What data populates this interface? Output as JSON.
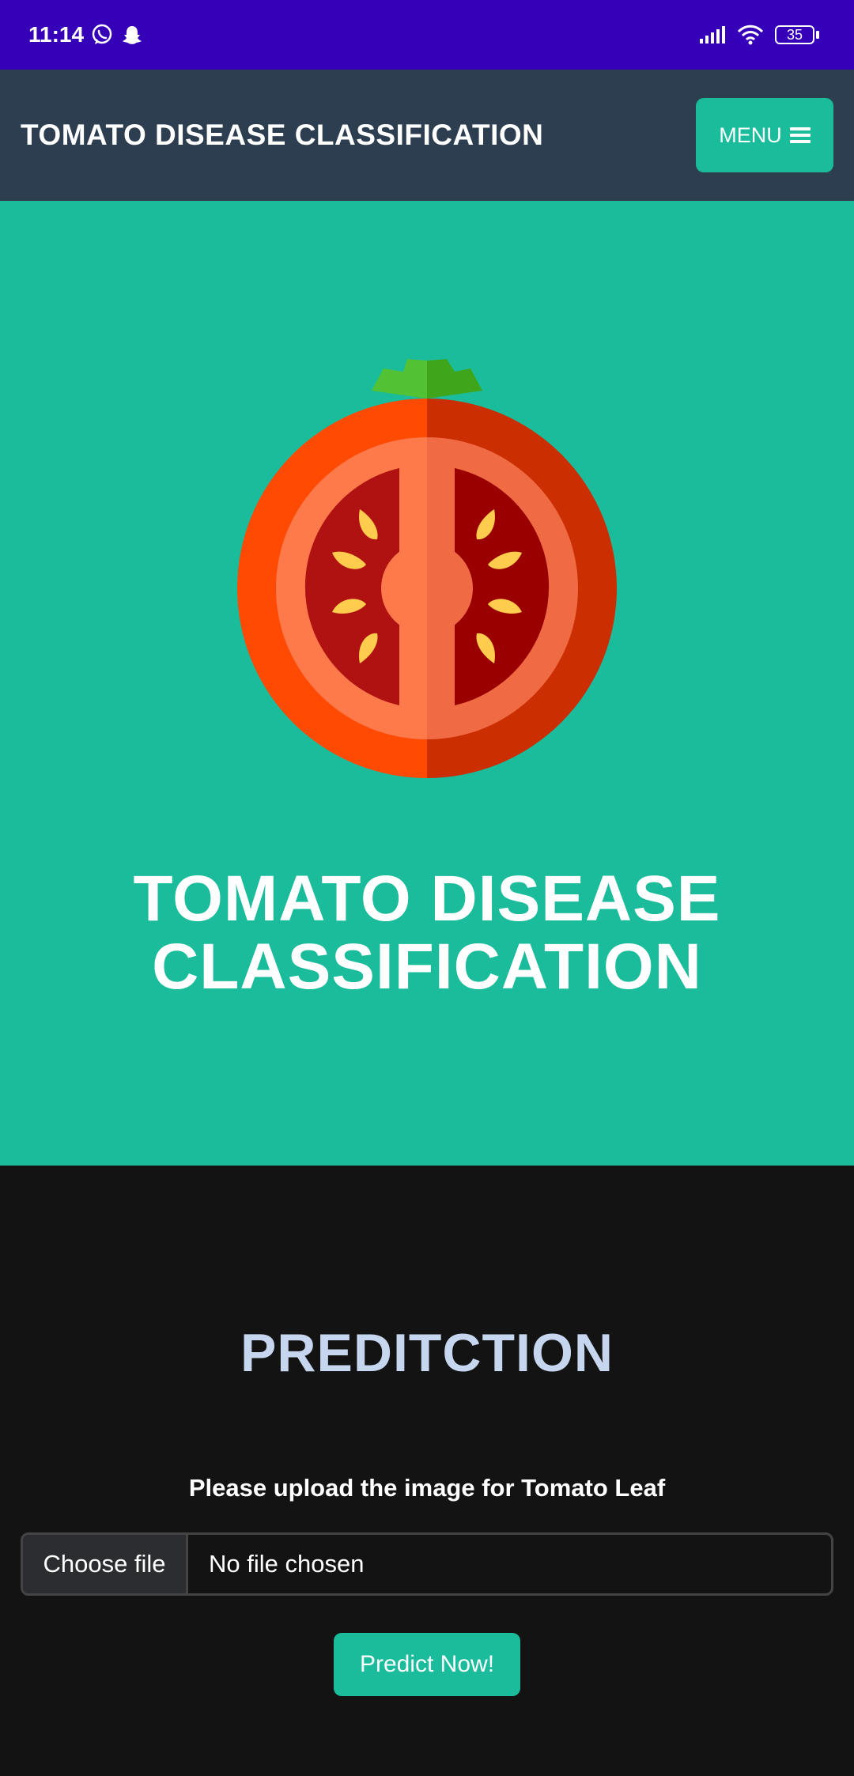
{
  "status_bar": {
    "time": "11:14",
    "battery": "35",
    "icons": [
      "whatsapp-icon",
      "snapchat-icon",
      "signal-icon",
      "wifi-icon",
      "battery-icon"
    ]
  },
  "navbar": {
    "brand": "TOMATO DISEASE CLASSIFICATION",
    "menu_label": "MENU",
    "menu_icon": "hamburger-icon"
  },
  "hero": {
    "title_line1": "TOMATO DISEASE",
    "title_line2": "CLASSIFICATION",
    "image": "tomato-icon"
  },
  "prediction": {
    "title": "PREDITCTION",
    "upload_label": "Please upload the image for Tomato Leaf",
    "choose_file_label": "Choose file",
    "file_status": "No file chosen",
    "predict_button": "Predict Now!"
  },
  "colors": {
    "status_bar": "#3600b8",
    "navbar": "#2d3e50",
    "accent": "#1abc9c",
    "dark_bg": "#131313",
    "section_title": "#c6d6ee"
  }
}
